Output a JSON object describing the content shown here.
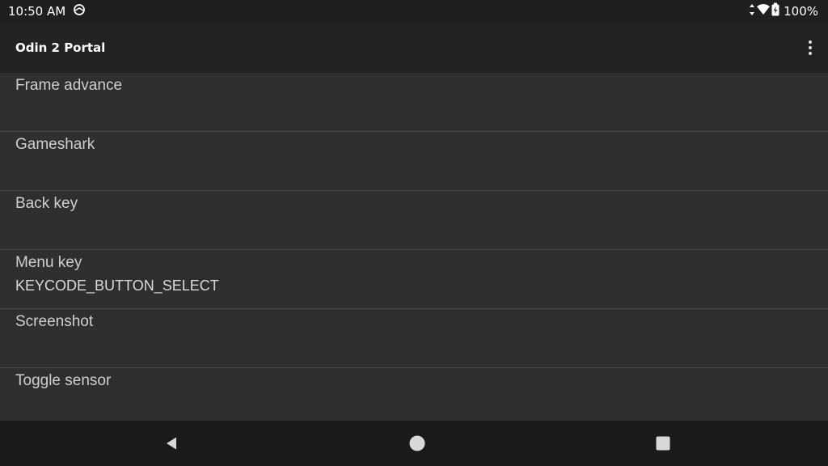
{
  "status_bar": {
    "time": "10:50 AM",
    "battery_percent": "100%",
    "icons": [
      "sync-icon",
      "data-arrows-icon",
      "wifi-icon",
      "battery-charging-icon"
    ]
  },
  "app_bar": {
    "title": "Odin 2 Portal",
    "menu_icon": "more-vert-icon"
  },
  "list": {
    "items": [
      {
        "label": "Frame advance",
        "value": ""
      },
      {
        "label": "Gameshark",
        "value": ""
      },
      {
        "label": "Back key",
        "value": ""
      },
      {
        "label": "Menu key",
        "value": "KEYCODE_BUTTON_SELECT"
      },
      {
        "label": "Screenshot",
        "value": ""
      },
      {
        "label": "Toggle sensor",
        "value": ""
      }
    ]
  },
  "nav_bar": {
    "icons": [
      "back-icon",
      "home-icon",
      "recents-icon"
    ]
  },
  "colors": {
    "background": "#2f2f2f",
    "app_bar": "#232323",
    "status_bar": "#1f1f1f",
    "nav_bar": "#1a1a1a",
    "divider": "#4a4a4a"
  }
}
